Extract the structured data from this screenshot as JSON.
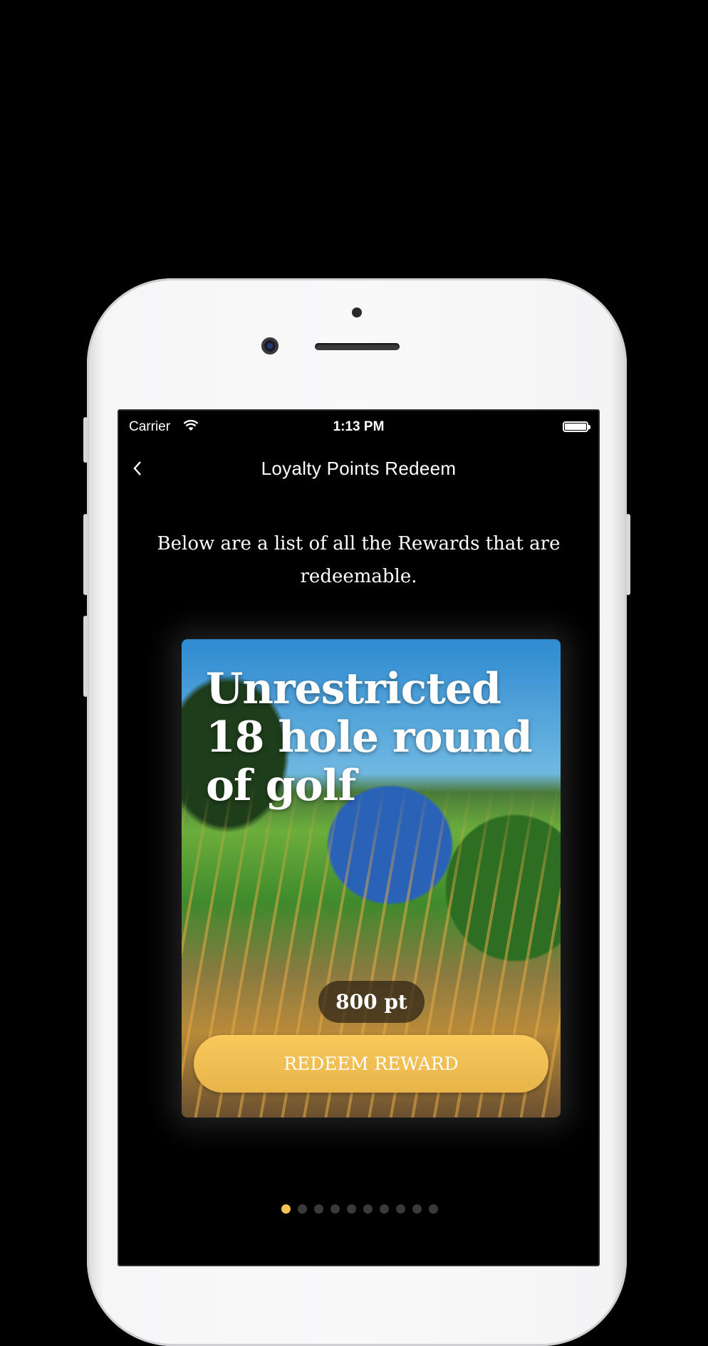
{
  "status_bar": {
    "carrier": "Carrier",
    "time": "1:13 PM",
    "wifi_icon": "wifi-icon",
    "battery_icon": "battery-icon",
    "battery_level": 1.0
  },
  "nav": {
    "back_icon": "chevron-left-icon",
    "title": "Loyalty Points Redeem"
  },
  "description": "Below are a list of all the Rewards that are redeemable.",
  "reward": {
    "title": "Unrestricted 18 hole round of golf",
    "points": "800 pt",
    "button_label": "REDEEM REWARD"
  },
  "pager": {
    "total": 10,
    "current": 1
  },
  "colors": {
    "accent": "#f6c453",
    "background": "#000000",
    "dot_inactive": "#3a3a3a"
  }
}
